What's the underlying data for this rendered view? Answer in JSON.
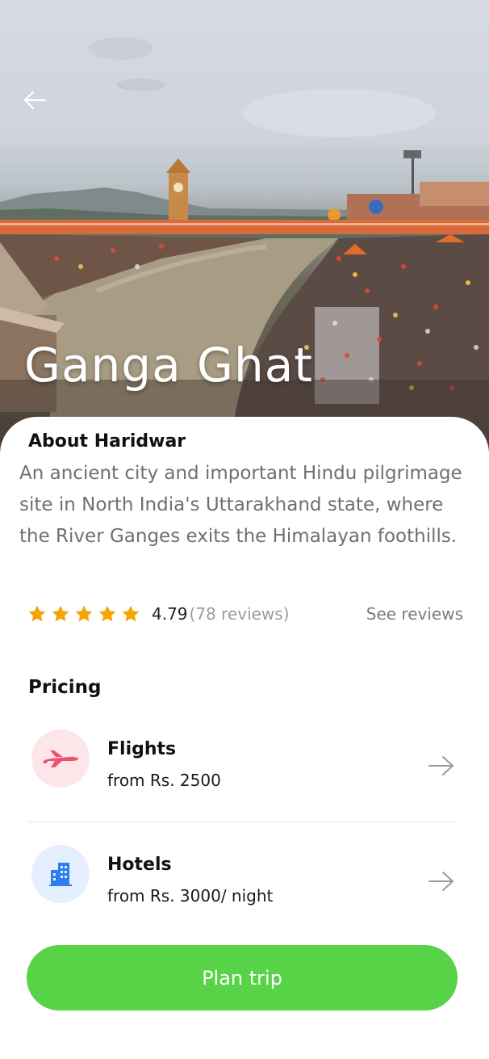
{
  "hero": {
    "title": "Ganga Ghat",
    "back_icon": "arrow-left-icon"
  },
  "about": {
    "heading": "About Haridwar",
    "description": "An ancient city and important Hindu pilgrimage site in North India's Uttarakhand state, where the River Ganges exits the Himalayan foothills."
  },
  "rating": {
    "stars": 5,
    "value": "4.79",
    "count": "(78 reviews)",
    "see_reviews": "See reviews",
    "star_color": "#f5a400"
  },
  "pricing": {
    "heading": "Pricing",
    "items": [
      {
        "name": "Flights",
        "price": "from Rs. 2500",
        "icon": "airplane-icon",
        "icon_color": "#f0506e"
      },
      {
        "name": "Hotels",
        "price": "from Rs. 3000/ night",
        "icon": "building-icon",
        "icon_color": "#2d7ff0"
      }
    ]
  },
  "cta": {
    "label": "Plan trip",
    "color": "#58d246"
  }
}
